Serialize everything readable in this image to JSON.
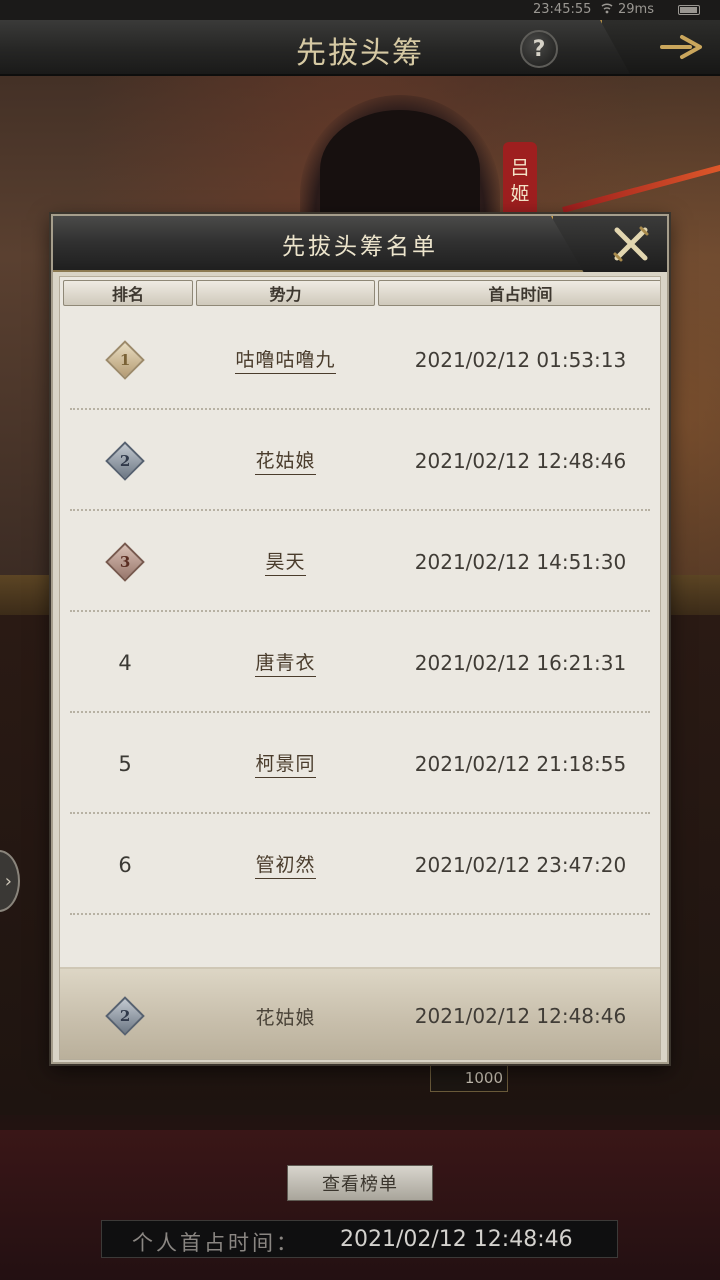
{
  "status_bar": {
    "time": "23:45:55",
    "ping": "29ms"
  },
  "title_bar": {
    "title": "先拔头筹",
    "help_label": "?"
  },
  "background": {
    "character_name_tag": [
      "吕",
      "姬"
    ],
    "reward_value": "1000"
  },
  "dialog": {
    "title": "先拔头筹名单",
    "columns": {
      "rank": "排名",
      "faction": "势力",
      "time": "首占时间"
    },
    "rows": [
      {
        "rank": "1",
        "medal": "gold",
        "faction": "咕噜咕噜九",
        "time": "2021/02/12 01:53:13"
      },
      {
        "rank": "2",
        "medal": "silver",
        "faction": "花姑娘",
        "time": "2021/02/12 12:48:46"
      },
      {
        "rank": "3",
        "medal": "bronze",
        "faction": "昊天",
        "time": "2021/02/12 14:51:30"
      },
      {
        "rank": "4",
        "medal": "none",
        "faction": "唐青衣",
        "time": "2021/02/12 16:21:31"
      },
      {
        "rank": "5",
        "medal": "none",
        "faction": "柯景同",
        "time": "2021/02/12 21:18:55"
      },
      {
        "rank": "6",
        "medal": "none",
        "faction": "管初然",
        "time": "2021/02/12 23:47:20"
      }
    ],
    "self_row": {
      "rank": "2",
      "medal": "silver",
      "faction": "花姑娘",
      "time": "2021/02/12 12:48:46"
    }
  },
  "bottom": {
    "view_list_label": "查看榜单",
    "personal_label": "个人首占时间：",
    "personal_time": "2021/02/12 12:48:46"
  },
  "colors": {
    "accent_gold": "#c49a4a",
    "panel": "#ebe8e1",
    "title_text": "#d6c9a3"
  }
}
